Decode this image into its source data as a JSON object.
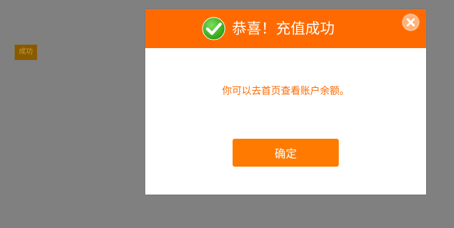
{
  "background": {
    "button_label": "成功"
  },
  "dialog": {
    "title": "恭喜！充值成功",
    "message": "你可以去首页查看账户余额。",
    "confirm_label": "确定",
    "header_icon": "check-circle-icon",
    "close_icon": "close-circle-icon"
  },
  "colors": {
    "accent": "#ff6a00",
    "button": "#ff7a00",
    "overlay": "#808080",
    "check": "#3cb520"
  }
}
